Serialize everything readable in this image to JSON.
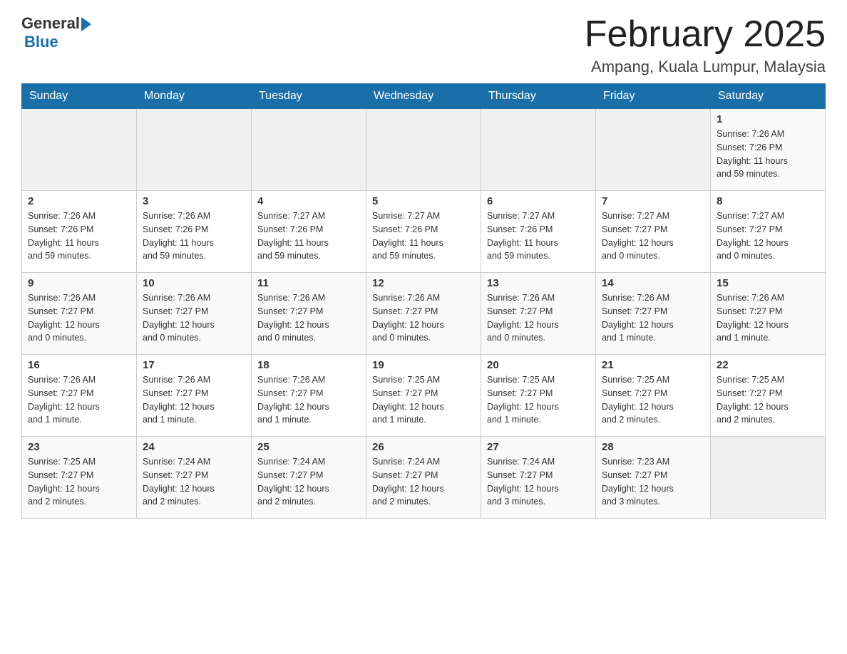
{
  "header": {
    "logo_general": "General",
    "logo_blue": "Blue",
    "title": "February 2025",
    "subtitle": "Ampang, Kuala Lumpur, Malaysia"
  },
  "days_of_week": [
    "Sunday",
    "Monday",
    "Tuesday",
    "Wednesday",
    "Thursday",
    "Friday",
    "Saturday"
  ],
  "weeks": [
    [
      {
        "day": "",
        "info": ""
      },
      {
        "day": "",
        "info": ""
      },
      {
        "day": "",
        "info": ""
      },
      {
        "day": "",
        "info": ""
      },
      {
        "day": "",
        "info": ""
      },
      {
        "day": "",
        "info": ""
      },
      {
        "day": "1",
        "info": "Sunrise: 7:26 AM\nSunset: 7:26 PM\nDaylight: 11 hours\nand 59 minutes."
      }
    ],
    [
      {
        "day": "2",
        "info": "Sunrise: 7:26 AM\nSunset: 7:26 PM\nDaylight: 11 hours\nand 59 minutes."
      },
      {
        "day": "3",
        "info": "Sunrise: 7:26 AM\nSunset: 7:26 PM\nDaylight: 11 hours\nand 59 minutes."
      },
      {
        "day": "4",
        "info": "Sunrise: 7:27 AM\nSunset: 7:26 PM\nDaylight: 11 hours\nand 59 minutes."
      },
      {
        "day": "5",
        "info": "Sunrise: 7:27 AM\nSunset: 7:26 PM\nDaylight: 11 hours\nand 59 minutes."
      },
      {
        "day": "6",
        "info": "Sunrise: 7:27 AM\nSunset: 7:26 PM\nDaylight: 11 hours\nand 59 minutes."
      },
      {
        "day": "7",
        "info": "Sunrise: 7:27 AM\nSunset: 7:27 PM\nDaylight: 12 hours\nand 0 minutes."
      },
      {
        "day": "8",
        "info": "Sunrise: 7:27 AM\nSunset: 7:27 PM\nDaylight: 12 hours\nand 0 minutes."
      }
    ],
    [
      {
        "day": "9",
        "info": "Sunrise: 7:26 AM\nSunset: 7:27 PM\nDaylight: 12 hours\nand 0 minutes."
      },
      {
        "day": "10",
        "info": "Sunrise: 7:26 AM\nSunset: 7:27 PM\nDaylight: 12 hours\nand 0 minutes."
      },
      {
        "day": "11",
        "info": "Sunrise: 7:26 AM\nSunset: 7:27 PM\nDaylight: 12 hours\nand 0 minutes."
      },
      {
        "day": "12",
        "info": "Sunrise: 7:26 AM\nSunset: 7:27 PM\nDaylight: 12 hours\nand 0 minutes."
      },
      {
        "day": "13",
        "info": "Sunrise: 7:26 AM\nSunset: 7:27 PM\nDaylight: 12 hours\nand 0 minutes."
      },
      {
        "day": "14",
        "info": "Sunrise: 7:26 AM\nSunset: 7:27 PM\nDaylight: 12 hours\nand 1 minute."
      },
      {
        "day": "15",
        "info": "Sunrise: 7:26 AM\nSunset: 7:27 PM\nDaylight: 12 hours\nand 1 minute."
      }
    ],
    [
      {
        "day": "16",
        "info": "Sunrise: 7:26 AM\nSunset: 7:27 PM\nDaylight: 12 hours\nand 1 minute."
      },
      {
        "day": "17",
        "info": "Sunrise: 7:26 AM\nSunset: 7:27 PM\nDaylight: 12 hours\nand 1 minute."
      },
      {
        "day": "18",
        "info": "Sunrise: 7:26 AM\nSunset: 7:27 PM\nDaylight: 12 hours\nand 1 minute."
      },
      {
        "day": "19",
        "info": "Sunrise: 7:25 AM\nSunset: 7:27 PM\nDaylight: 12 hours\nand 1 minute."
      },
      {
        "day": "20",
        "info": "Sunrise: 7:25 AM\nSunset: 7:27 PM\nDaylight: 12 hours\nand 1 minute."
      },
      {
        "day": "21",
        "info": "Sunrise: 7:25 AM\nSunset: 7:27 PM\nDaylight: 12 hours\nand 2 minutes."
      },
      {
        "day": "22",
        "info": "Sunrise: 7:25 AM\nSunset: 7:27 PM\nDaylight: 12 hours\nand 2 minutes."
      }
    ],
    [
      {
        "day": "23",
        "info": "Sunrise: 7:25 AM\nSunset: 7:27 PM\nDaylight: 12 hours\nand 2 minutes."
      },
      {
        "day": "24",
        "info": "Sunrise: 7:24 AM\nSunset: 7:27 PM\nDaylight: 12 hours\nand 2 minutes."
      },
      {
        "day": "25",
        "info": "Sunrise: 7:24 AM\nSunset: 7:27 PM\nDaylight: 12 hours\nand 2 minutes."
      },
      {
        "day": "26",
        "info": "Sunrise: 7:24 AM\nSunset: 7:27 PM\nDaylight: 12 hours\nand 2 minutes."
      },
      {
        "day": "27",
        "info": "Sunrise: 7:24 AM\nSunset: 7:27 PM\nDaylight: 12 hours\nand 3 minutes."
      },
      {
        "day": "28",
        "info": "Sunrise: 7:23 AM\nSunset: 7:27 PM\nDaylight: 12 hours\nand 3 minutes."
      },
      {
        "day": "",
        "info": ""
      }
    ]
  ]
}
